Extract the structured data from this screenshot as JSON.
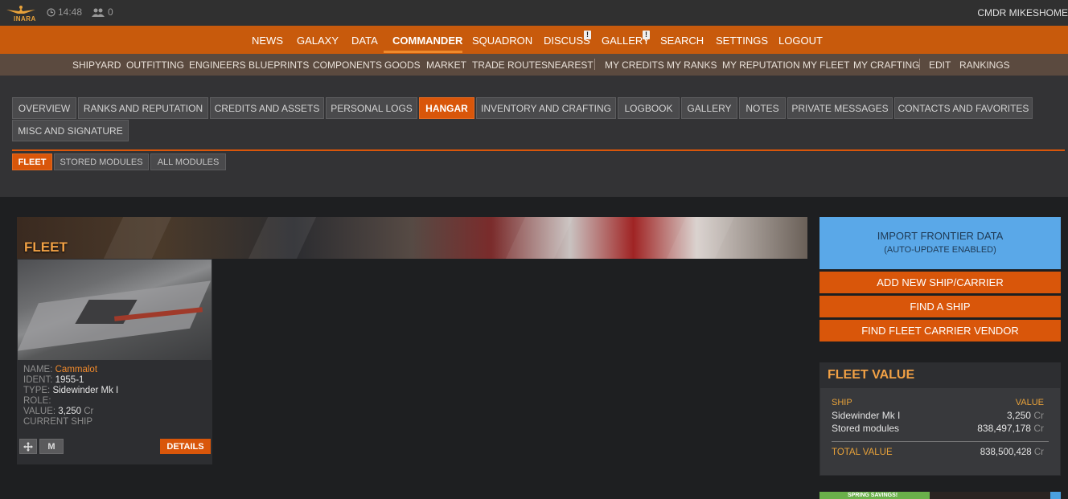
{
  "topbar": {
    "logo_text": "INARA",
    "time": "14:48",
    "online_count": "0",
    "cmdr_name": "CMDR MIKESHOME"
  },
  "main_nav": [
    "NEWS",
    "GALAXY",
    "DATA",
    "COMMANDER",
    "SQUADRON",
    "DISCUSS",
    "GALLERY",
    "SEARCH",
    "SETTINGS",
    "LOGOUT"
  ],
  "main_nav_active": "COMMANDER",
  "main_nav_badge": "!",
  "sub_nav": [
    "SHIPYARD",
    "OUTFITTING",
    "ENGINEERS",
    "BLUEPRINTS",
    "COMPONENTS",
    "GOODS",
    "MARKET",
    "TRADE ROUTES",
    "NEAREST",
    "MY CREDITS",
    "MY RANKS",
    "MY REPUTATION",
    "MY FLEET",
    "MY CRAFTING",
    "EDIT",
    "RANKINGS"
  ],
  "tabs": [
    "OVERVIEW",
    "RANKS AND REPUTATION",
    "CREDITS AND ASSETS",
    "PERSONAL LOGS",
    "HANGAR",
    "INVENTORY AND CRAFTING",
    "LOGBOOK",
    "GALLERY",
    "NOTES",
    "PRIVATE MESSAGES",
    "CONTACTS AND FAVORITES",
    "MISC AND SIGNATURE"
  ],
  "tabs_active": "HANGAR",
  "subtabs": [
    "FLEET",
    "STORED MODULES",
    "ALL MODULES"
  ],
  "subtabs_active": "FLEET",
  "fleet": {
    "title": "FLEET",
    "ship": {
      "name_label": "NAME:",
      "name": "Cammalot",
      "ident_label": "IDENT:",
      "ident": "1955-1",
      "type_label": "TYPE:",
      "type": "Sidewinder Mk I",
      "role_label": "ROLE:",
      "role": "",
      "value_label": "VALUE:",
      "value": "3,250",
      "currency": "Cr",
      "status": "CURRENT SHIP",
      "m_button": "M",
      "details_button": "DETAILS"
    }
  },
  "sidebar": {
    "import_title": "IMPORT FRONTIER DATA",
    "import_subtitle": "(AUTO-UPDATE ENABLED)",
    "add_ship": "ADD NEW SHIP/CARRIER",
    "find_ship": "FIND A SHIP",
    "find_carrier_vendor": "FIND FLEET CARRIER VENDOR"
  },
  "fleet_value": {
    "title": "FLEET VALUE",
    "col_ship": "SHIP",
    "col_value": "VALUE",
    "rows": [
      {
        "ship": "Sidewinder Mk I",
        "value": "3,250",
        "unit": "Cr"
      },
      {
        "ship": "Stored modules",
        "value": "838,497,178",
        "unit": "Cr"
      }
    ],
    "total_label": "TOTAL VALUE",
    "total_value": "838,500,428",
    "total_unit": "Cr"
  },
  "ad": {
    "text": "SPRING SAVINGS!"
  },
  "colors": {
    "accent": "#d9560a",
    "main_nav_bg": "#c85a0c",
    "sub_nav_bg": "#5b4a3f",
    "import_button": "#5aa8e8",
    "heading_orange": "#f2a145"
  }
}
